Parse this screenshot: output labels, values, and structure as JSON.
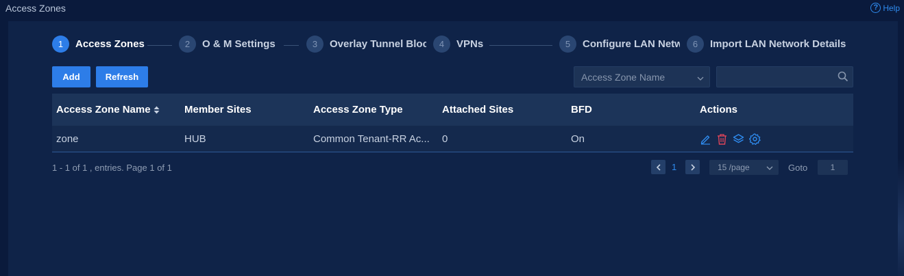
{
  "page": {
    "title": "Access Zones",
    "help_label": "Help"
  },
  "steps": [
    {
      "num": "1",
      "label": "Access Zones",
      "active": true
    },
    {
      "num": "2",
      "label": "O & M Settings",
      "active": false
    },
    {
      "num": "3",
      "label": "Overlay Tunnel Bloc",
      "active": false
    },
    {
      "num": "4",
      "label": "VPNs",
      "active": false
    },
    {
      "num": "5",
      "label": "Configure LAN Netw",
      "active": false
    },
    {
      "num": "6",
      "label": "Import LAN Network Details",
      "active": false
    }
  ],
  "toolbar": {
    "add_label": "Add",
    "refresh_label": "Refresh",
    "filter_selected": "Access Zone Name",
    "search_value": ""
  },
  "table": {
    "headers": [
      "Access Zone Name",
      "Member Sites",
      "Access Zone Type",
      "Attached Sites",
      "BFD",
      "Actions"
    ],
    "rows": [
      {
        "name": "zone",
        "member_sites": "HUB",
        "type": "Common Tenant-RR Ac...",
        "attached_sites": "0",
        "bfd": "On"
      }
    ]
  },
  "pagination": {
    "summary": "1 - 1 of 1 , entries. Page 1 of 1",
    "current_page": "1",
    "page_size": "15 /page",
    "goto_label": "Goto",
    "goto_value": "1"
  },
  "colors": {
    "accent": "#2d7de8",
    "background": "#0a1a3c",
    "panel": "#0f2348",
    "delete": "#e0455a"
  },
  "icons": [
    "help-circle-icon",
    "search-icon",
    "sort-icon",
    "edit-icon",
    "delete-icon",
    "layers-icon",
    "settings-icon",
    "chevron-left-icon",
    "chevron-right-icon",
    "chevron-down-icon"
  ]
}
